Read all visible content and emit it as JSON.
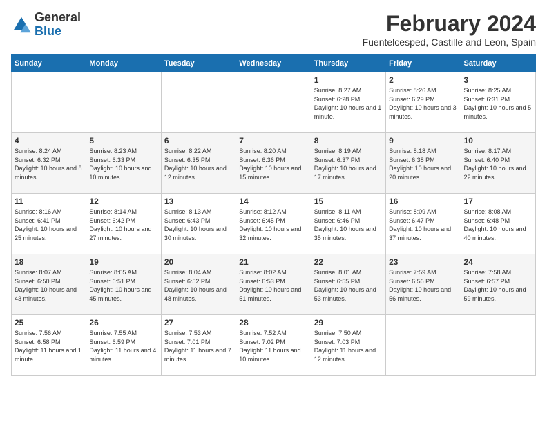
{
  "header": {
    "logo_general": "General",
    "logo_blue": "Blue",
    "month_title": "February 2024",
    "location": "Fuentelcesped, Castille and Leon, Spain"
  },
  "weekdays": [
    "Sunday",
    "Monday",
    "Tuesday",
    "Wednesday",
    "Thursday",
    "Friday",
    "Saturday"
  ],
  "weeks": [
    [
      {
        "day": "",
        "info": ""
      },
      {
        "day": "",
        "info": ""
      },
      {
        "day": "",
        "info": ""
      },
      {
        "day": "",
        "info": ""
      },
      {
        "day": "1",
        "info": "Sunrise: 8:27 AM\nSunset: 6:28 PM\nDaylight: 10 hours\nand 1 minute."
      },
      {
        "day": "2",
        "info": "Sunrise: 8:26 AM\nSunset: 6:29 PM\nDaylight: 10 hours\nand 3 minutes."
      },
      {
        "day": "3",
        "info": "Sunrise: 8:25 AM\nSunset: 6:31 PM\nDaylight: 10 hours\nand 5 minutes."
      }
    ],
    [
      {
        "day": "4",
        "info": "Sunrise: 8:24 AM\nSunset: 6:32 PM\nDaylight: 10 hours\nand 8 minutes."
      },
      {
        "day": "5",
        "info": "Sunrise: 8:23 AM\nSunset: 6:33 PM\nDaylight: 10 hours\nand 10 minutes."
      },
      {
        "day": "6",
        "info": "Sunrise: 8:22 AM\nSunset: 6:35 PM\nDaylight: 10 hours\nand 12 minutes."
      },
      {
        "day": "7",
        "info": "Sunrise: 8:20 AM\nSunset: 6:36 PM\nDaylight: 10 hours\nand 15 minutes."
      },
      {
        "day": "8",
        "info": "Sunrise: 8:19 AM\nSunset: 6:37 PM\nDaylight: 10 hours\nand 17 minutes."
      },
      {
        "day": "9",
        "info": "Sunrise: 8:18 AM\nSunset: 6:38 PM\nDaylight: 10 hours\nand 20 minutes."
      },
      {
        "day": "10",
        "info": "Sunrise: 8:17 AM\nSunset: 6:40 PM\nDaylight: 10 hours\nand 22 minutes."
      }
    ],
    [
      {
        "day": "11",
        "info": "Sunrise: 8:16 AM\nSunset: 6:41 PM\nDaylight: 10 hours\nand 25 minutes."
      },
      {
        "day": "12",
        "info": "Sunrise: 8:14 AM\nSunset: 6:42 PM\nDaylight: 10 hours\nand 27 minutes."
      },
      {
        "day": "13",
        "info": "Sunrise: 8:13 AM\nSunset: 6:43 PM\nDaylight: 10 hours\nand 30 minutes."
      },
      {
        "day": "14",
        "info": "Sunrise: 8:12 AM\nSunset: 6:45 PM\nDaylight: 10 hours\nand 32 minutes."
      },
      {
        "day": "15",
        "info": "Sunrise: 8:11 AM\nSunset: 6:46 PM\nDaylight: 10 hours\nand 35 minutes."
      },
      {
        "day": "16",
        "info": "Sunrise: 8:09 AM\nSunset: 6:47 PM\nDaylight: 10 hours\nand 37 minutes."
      },
      {
        "day": "17",
        "info": "Sunrise: 8:08 AM\nSunset: 6:48 PM\nDaylight: 10 hours\nand 40 minutes."
      }
    ],
    [
      {
        "day": "18",
        "info": "Sunrise: 8:07 AM\nSunset: 6:50 PM\nDaylight: 10 hours\nand 43 minutes."
      },
      {
        "day": "19",
        "info": "Sunrise: 8:05 AM\nSunset: 6:51 PM\nDaylight: 10 hours\nand 45 minutes."
      },
      {
        "day": "20",
        "info": "Sunrise: 8:04 AM\nSunset: 6:52 PM\nDaylight: 10 hours\nand 48 minutes."
      },
      {
        "day": "21",
        "info": "Sunrise: 8:02 AM\nSunset: 6:53 PM\nDaylight: 10 hours\nand 51 minutes."
      },
      {
        "day": "22",
        "info": "Sunrise: 8:01 AM\nSunset: 6:55 PM\nDaylight: 10 hours\nand 53 minutes."
      },
      {
        "day": "23",
        "info": "Sunrise: 7:59 AM\nSunset: 6:56 PM\nDaylight: 10 hours\nand 56 minutes."
      },
      {
        "day": "24",
        "info": "Sunrise: 7:58 AM\nSunset: 6:57 PM\nDaylight: 10 hours\nand 59 minutes."
      }
    ],
    [
      {
        "day": "25",
        "info": "Sunrise: 7:56 AM\nSunset: 6:58 PM\nDaylight: 11 hours\nand 1 minute."
      },
      {
        "day": "26",
        "info": "Sunrise: 7:55 AM\nSunset: 6:59 PM\nDaylight: 11 hours\nand 4 minutes."
      },
      {
        "day": "27",
        "info": "Sunrise: 7:53 AM\nSunset: 7:01 PM\nDaylight: 11 hours\nand 7 minutes."
      },
      {
        "day": "28",
        "info": "Sunrise: 7:52 AM\nSunset: 7:02 PM\nDaylight: 11 hours\nand 10 minutes."
      },
      {
        "day": "29",
        "info": "Sunrise: 7:50 AM\nSunset: 7:03 PM\nDaylight: 11 hours\nand 12 minutes."
      },
      {
        "day": "",
        "info": ""
      },
      {
        "day": "",
        "info": ""
      }
    ]
  ]
}
